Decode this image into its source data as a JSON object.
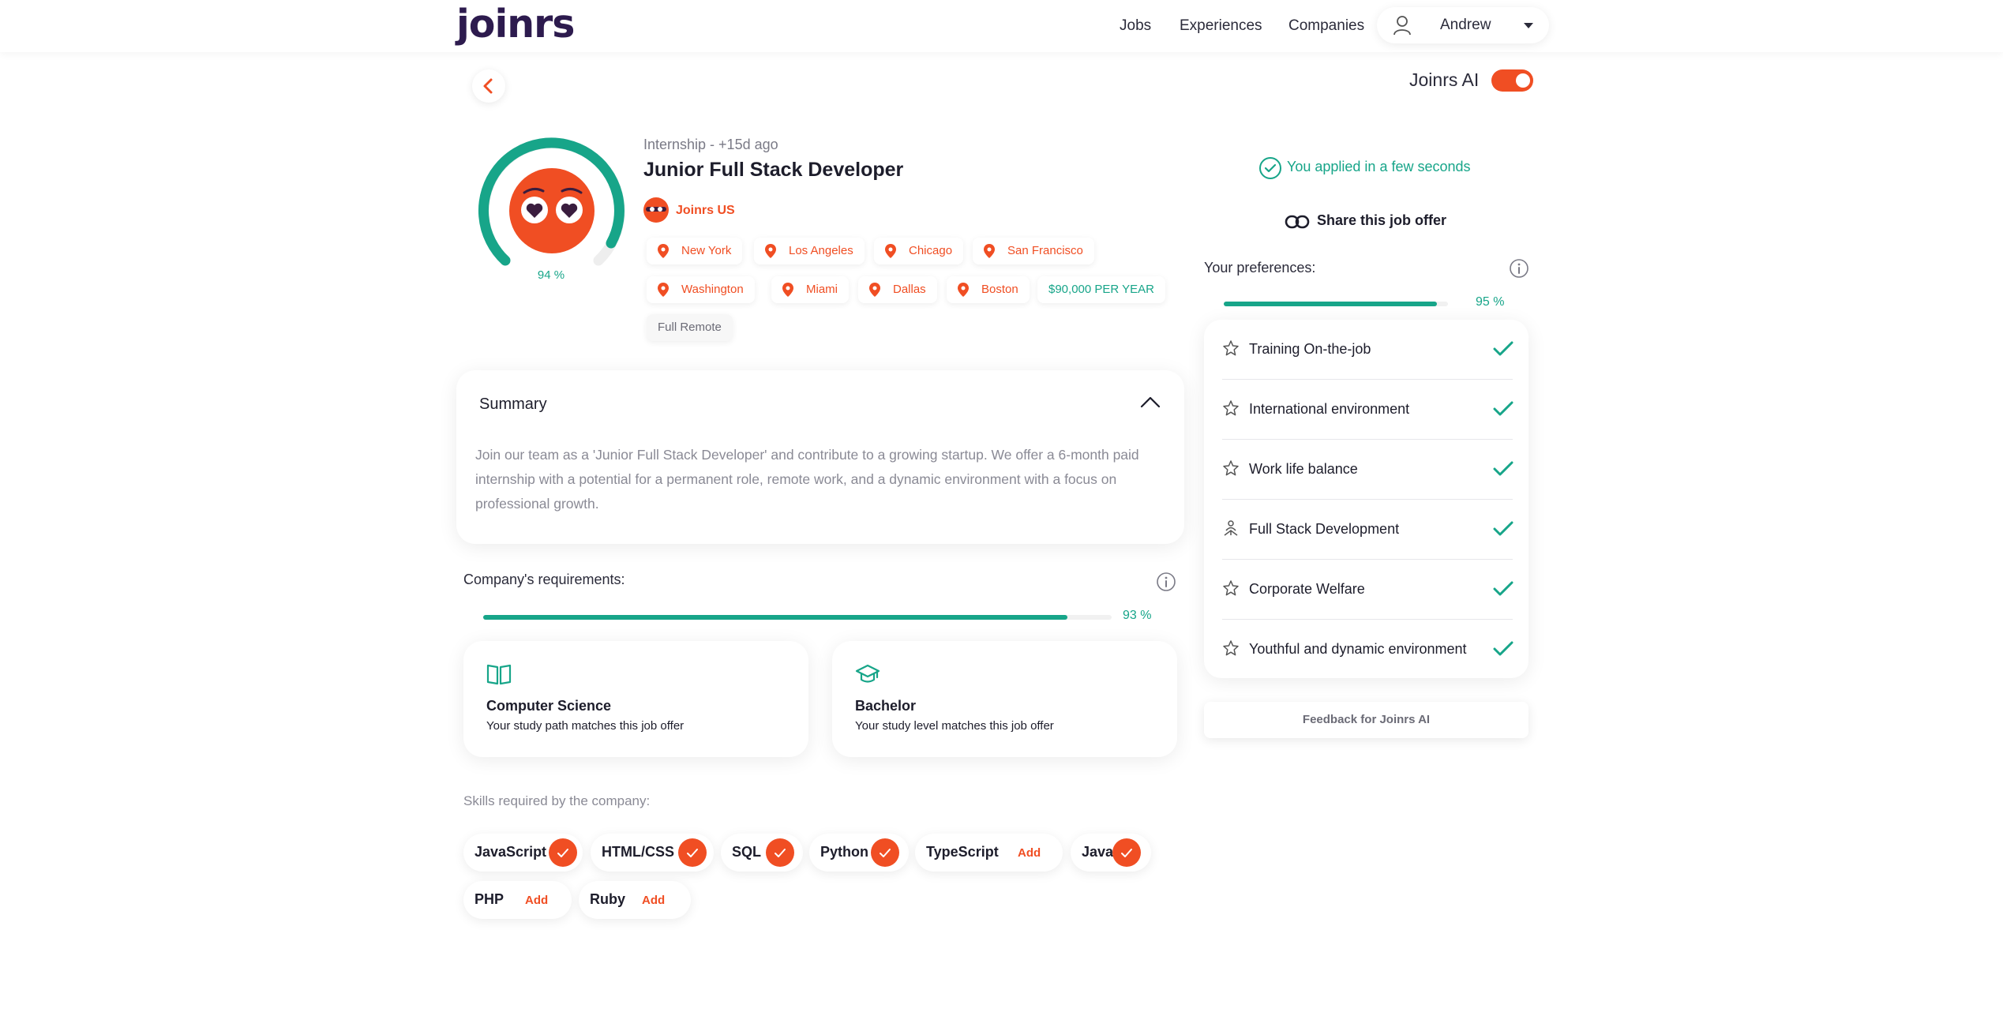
{
  "header": {
    "logo": "joinrs",
    "nav": [
      "Jobs",
      "Experiences",
      "Companies"
    ],
    "user": "Andrew"
  },
  "ai_toggle": {
    "label": "Joinrs AI",
    "enabled": true
  },
  "job": {
    "meta": "Internship - +15d ago",
    "title": "Junior Full Stack Developer",
    "company": "Joinrs US",
    "match_score": "94 %",
    "locations": [
      "New York",
      "Los Angeles",
      "Chicago",
      "San Francisco",
      "Washington",
      "Miami",
      "Dallas",
      "Boston"
    ],
    "salary": "$90,000 PER YEAR",
    "work_mode": "Full Remote"
  },
  "summary": {
    "title": "Summary",
    "text": "Join our team as a 'Junior Full Stack Developer' and contribute to a growing startup. We offer a 6-month paid internship with a potential for a permanent role, remote work, and a dynamic environment with a focus on professional growth."
  },
  "requirements": {
    "label": "Company's requirements:",
    "percent_text": "93 %",
    "percent": 93,
    "cards": [
      {
        "icon": "book-icon",
        "title": "Computer Science",
        "subtitle": "Your study path matches this job offer"
      },
      {
        "icon": "graduation-cap-icon",
        "title": "Bachelor",
        "subtitle": "Your study level matches this job offer"
      }
    ]
  },
  "skills": {
    "label": "Skills required by the company:",
    "add_label": "Add",
    "items": [
      {
        "name": "JavaScript",
        "matched": true
      },
      {
        "name": "HTML/CSS",
        "matched": true
      },
      {
        "name": "SQL",
        "matched": true
      },
      {
        "name": "Python",
        "matched": true
      },
      {
        "name": "TypeScript",
        "matched": false
      },
      {
        "name": "Java",
        "matched": true
      },
      {
        "name": "PHP",
        "matched": false
      },
      {
        "name": "Ruby",
        "matched": false
      }
    ]
  },
  "application": {
    "applied": "You applied in a few seconds",
    "share": "Share this job offer"
  },
  "preferences": {
    "label": "Your preferences:",
    "percent_text": "95 %",
    "percent": 95,
    "items": [
      {
        "label": "Training On-the-job",
        "icon": "star-icon"
      },
      {
        "label": "International environment",
        "icon": "star-icon"
      },
      {
        "label": "Work life balance",
        "icon": "star-icon"
      },
      {
        "label": "Full Stack Development",
        "icon": "person-network-icon"
      },
      {
        "label": "Corporate Welfare",
        "icon": "star-icon"
      },
      {
        "label": "Youthful and dynamic environment",
        "icon": "star-icon"
      }
    ]
  },
  "feedback": "Feedback for Joinrs AI",
  "colors": {
    "accent": "#f04e23",
    "green": "#17a589",
    "brand": "#2d1b4e"
  }
}
